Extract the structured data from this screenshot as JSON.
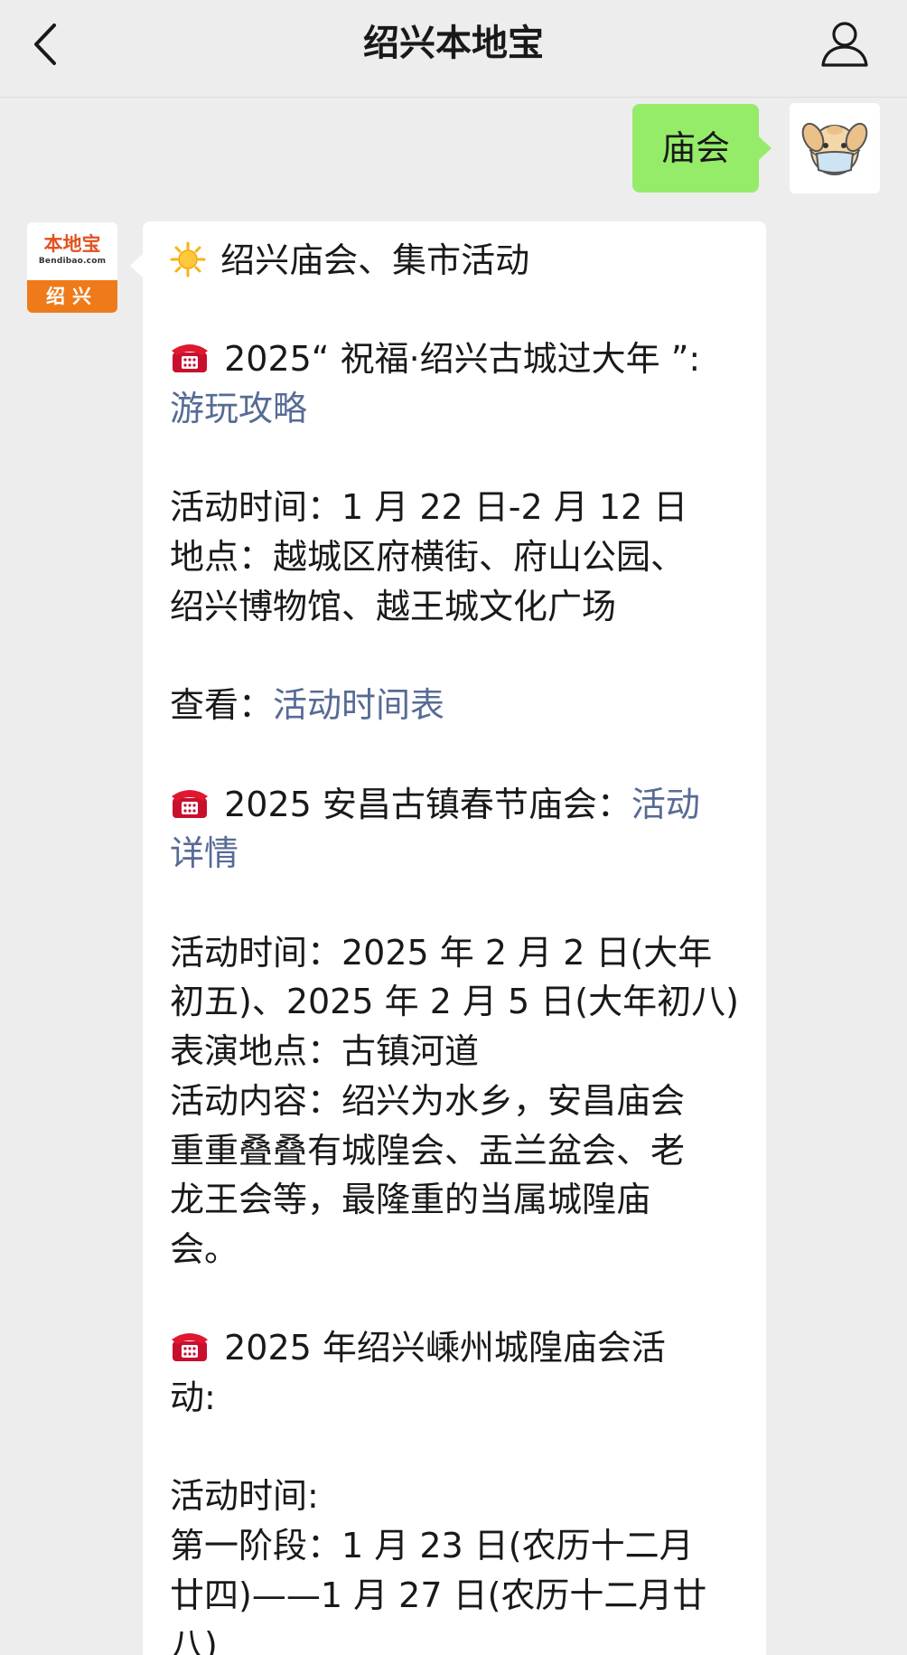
{
  "header": {
    "title": "绍兴本地宝",
    "back_icon": "chevron-left-icon",
    "profile_icon": "person-icon"
  },
  "outgoing": {
    "text": "庙会",
    "bubble_color": "#95ec69"
  },
  "bot_avatar": {
    "brand": "本地宝",
    "domain": "Bendibao.com",
    "city": "绍兴",
    "accent_color": "#ef7a1a"
  },
  "message": {
    "heading": "绍兴庙会、集市活动",
    "heading_icon": "sun-icon",
    "item_icon": "telephone-icon",
    "link_color": "#576b95",
    "item1": {
      "title_line1": "2025“ 祝福·绍兴古城过大年 ”:",
      "link": "游玩攻略",
      "time": "活动时间：1 月 22 日-2 月 12 日",
      "place_line1": "地点：越城区府横街、府山公园、",
      "place_line2": "绍兴博物馆、越王城文化广场",
      "view_label": "查看：",
      "view_link": "活动时间表"
    },
    "item2": {
      "title": "2025 安昌古镇春节庙会：",
      "link_line1": "活动",
      "link_line2": "详情",
      "time_line1": "活动时间：2025 年 2 月 2 日(大年",
      "time_line2": "初五)、2025 年 2 月 5 日(大年初八)",
      "place": "表演地点：古镇河道",
      "content_line1": "活动内容：绍兴为水乡，安昌庙会",
      "content_line2": "重重叠叠有城隍会、盂兰盆会、老",
      "content_line3": "龙王会等，最隆重的当属城隍庙",
      "content_line4": "会。"
    },
    "item3": {
      "title_line1": "2025 年绍兴嵊州城隍庙会活",
      "title_line2": "动:",
      "time_label": "活动时间:",
      "stage1_line1": "第一阶段：1 月 23 日(农历十二月",
      "stage1_line2": "廿四)——1 月 27 日(农历十二月廿",
      "stage1_line3": "八)"
    }
  }
}
